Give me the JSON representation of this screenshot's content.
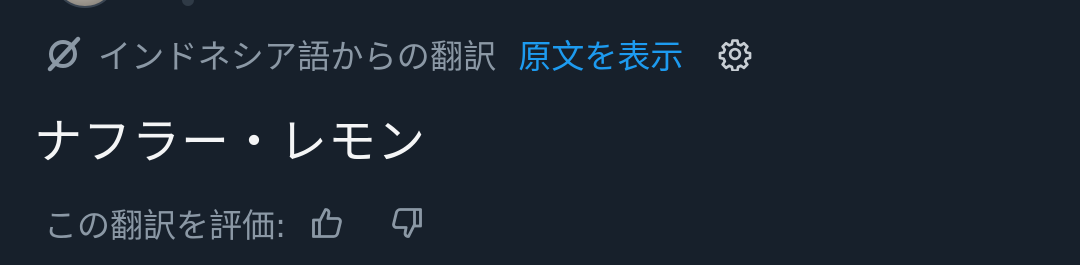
{
  "translation_bar": {
    "translated_from": "インドネシア語からの翻訳",
    "show_original": "原文を表示"
  },
  "post": {
    "translated_text": "ナフラー・レモン"
  },
  "rating": {
    "label": "この翻訳を評価:"
  },
  "icons": {
    "translate": "translate-icon",
    "settings": "gear-icon",
    "thumbs_up": "thumbs-up-icon",
    "thumbs_down": "thumbs-down-icon"
  },
  "colors": {
    "background": "#17202b",
    "secondary_text": "#8b98a5",
    "link": "#1d9bf0",
    "primary_text": "#f4f5f6"
  }
}
